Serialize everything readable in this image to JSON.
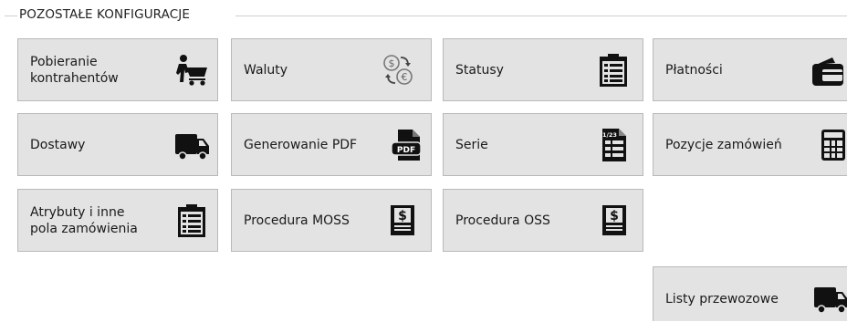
{
  "section": {
    "title": "POZOSTAŁE KONFIGURACJE"
  },
  "tiles": [
    {
      "label": "Pobieranie\nkontrahentów",
      "icon": "customer-cart-icon"
    },
    {
      "label": "Waluty",
      "icon": "currency-exchange-icon"
    },
    {
      "label": "Statusy",
      "icon": "clipboard-list-icon"
    },
    {
      "label": "Płatności",
      "icon": "wallet-card-icon"
    },
    {
      "label": "Dostawy",
      "icon": "delivery-truck-icon"
    },
    {
      "label": "Generowanie PDF",
      "icon": "pdf-file-icon"
    },
    {
      "label": "Serie",
      "icon": "numbered-document-icon"
    },
    {
      "label": "Pozycje zamówień",
      "icon": "calculator-icon"
    },
    {
      "label": "Atrybuty i inne\npola zamówienia",
      "icon": "clipboard-list-icon"
    },
    {
      "label": "Procedura MOSS",
      "icon": "dollar-document-icon"
    },
    {
      "label": "Procedura OSS",
      "icon": "dollar-document-icon"
    },
    {
      "label": "Listy przewozowe",
      "icon": "delivery-truck-icon"
    }
  ]
}
